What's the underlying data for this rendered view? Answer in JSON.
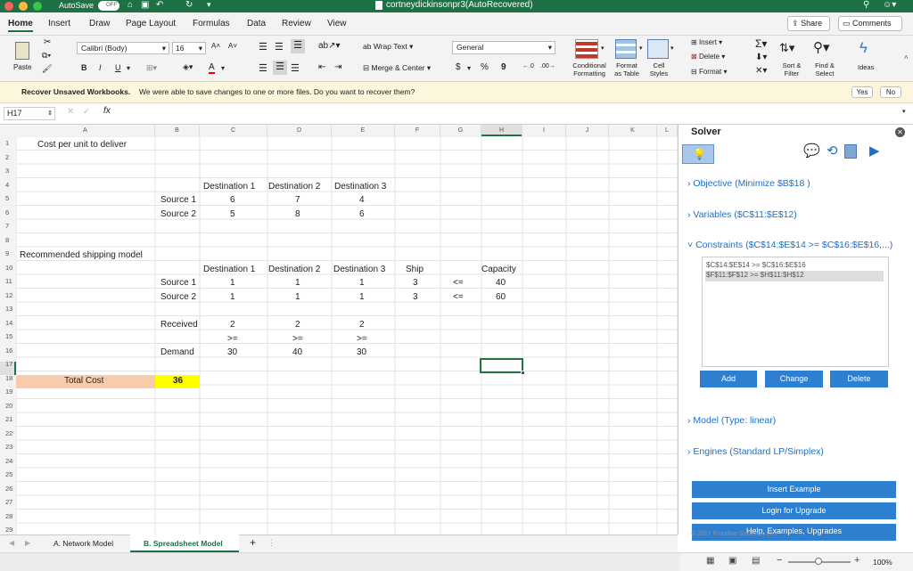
{
  "titlebar": {
    "autosave": "AutoSave",
    "autosave_state": "OFF",
    "filename": "cortneydickinsonpr3(AutoRecovered)"
  },
  "tabs": [
    "Home",
    "Insert",
    "Draw",
    "Page Layout",
    "Formulas",
    "Data",
    "Review",
    "View"
  ],
  "share_label": "Share",
  "comments_label": "Comments",
  "ribbon": {
    "paste": "Paste",
    "font_name": "Calibri (Body)",
    "font_size": "16",
    "bold": "B",
    "italic": "I",
    "underline": "U",
    "wrap_text": "Wrap Text",
    "merge_center": "Merge & Center",
    "number_format": "General",
    "currency": "$",
    "percent": "%",
    "comma": "9",
    "conditional_formatting": [
      "Conditional",
      "Formatting"
    ],
    "format_as_table": [
      "Format",
      "as Table"
    ],
    "cell_styles": [
      "Cell",
      "Styles"
    ],
    "insert": "Insert",
    "delete": "Delete",
    "format": "Format",
    "sort_filter": [
      "Sort &",
      "Filter"
    ],
    "find_select": [
      "Find &",
      "Select"
    ],
    "ideas": "Ideas"
  },
  "message": {
    "title": "Recover Unsaved Workbooks.",
    "text": "We were able to save changes to one or more files. Do you want to recover them?",
    "yes": "Yes",
    "no": "No"
  },
  "formula": {
    "name_box": "H17",
    "fx": "fx",
    "content": ""
  },
  "columns": [
    "A",
    "B",
    "C",
    "D",
    "E",
    "F",
    "G",
    "H",
    "I",
    "J",
    "K",
    "L"
  ],
  "rows": [
    "1",
    "2",
    "3",
    "4",
    "5",
    "6",
    "7",
    "8",
    "9",
    "10",
    "11",
    "12",
    "13",
    "14",
    "15",
    "16",
    "17",
    "18",
    "19",
    "20",
    "21",
    "22",
    "23",
    "24",
    "25",
    "26",
    "27",
    "28",
    "29",
    "30"
  ],
  "cells": {
    "A1": "Cost per unit to deliver",
    "C4": "Destination 1",
    "D4": "Destination 2",
    "E4": "Destination 3",
    "B5": "Source 1",
    "C5": "6",
    "D5": "7",
    "E5": "4",
    "B6": "Source 2",
    "C6": "5",
    "D6": "8",
    "E6": "6",
    "A9": "Recommended shipping model",
    "C10": "Destination 1",
    "D10": "Destination 2",
    "E10": "Destination 3",
    "F10": "Ship",
    "H10": "Capacity",
    "B11": "Source 1",
    "C11": "1",
    "D11": "1",
    "E11": "1",
    "F11": "3",
    "G11": "<=",
    "H11": "40",
    "B12": "Source 2",
    "C12": "1",
    "D12": "1",
    "E12": "1",
    "F12": "3",
    "G12": "<=",
    "H12": "60",
    "B14": "Received",
    "C14": "2",
    "D14": "2",
    "E14": "2",
    "C15": ">=",
    "D15": ">=",
    "E15": ">=",
    "B16": "Demand",
    "C16": "30",
    "D16": "40",
    "E16": "30",
    "A18": "Total Cost",
    "B18": "36"
  },
  "colors": {
    "excel_green": "#1e7145",
    "total_label_fill": "#f8cbad",
    "total_value_fill": "#ffff00",
    "solver_blue": "#2f7fd1",
    "selection_green": "#217346"
  },
  "solver": {
    "title": "Solver",
    "objective": "Objective (Minimize $B$18 )",
    "variables": "Variables ($C$11:$E$12)",
    "constraints": "Constraints ($C$14:$E$14 >= $C$16:$E$16,...)",
    "constraint_list": [
      "$C$14:$E$14 >= $C$16:$E$16",
      "$F$11:$F$12 >= $H$11:$H$12"
    ],
    "add": "Add",
    "change": "Change",
    "delete": "Delete",
    "model": "Model (Type: linear)",
    "engines": "Engines (Standard LP/Simplex)",
    "insert_example": "Insert Example",
    "login_upgrade": "Login for Upgrade",
    "help": "Help, Examples, Upgrades",
    "copyright": "© 2017 Frontline Systems, Inc."
  },
  "sheets": [
    "A. Network Model",
    "B. Spreadsheet Model"
  ],
  "zoom": "100%"
}
